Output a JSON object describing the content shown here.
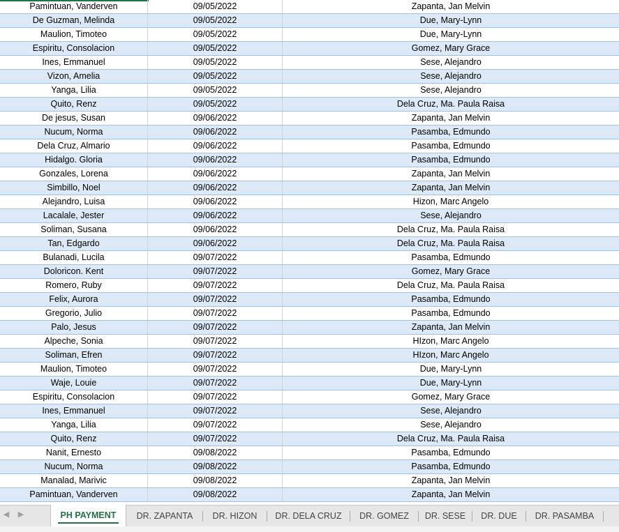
{
  "rows": [
    [
      "Pamintuan, Vanderven",
      "09/05/2022",
      "Zapanta, Jan Melvin"
    ],
    [
      "De Guzman, Melinda",
      "09/05/2022",
      "Due, Mary-Lynn"
    ],
    [
      "Maulion, Timoteo",
      "09/05/2022",
      "Due, Mary-Lynn"
    ],
    [
      "Espiritu, Consolacion",
      "09/05/2022",
      "Gomez, Mary Grace"
    ],
    [
      "Ines, Emmanuel",
      "09/05/2022",
      "Sese, Alejandro"
    ],
    [
      "Vizon, Amelia",
      "09/05/2022",
      "Sese, Alejandro"
    ],
    [
      "Yanga, Lilia",
      "09/05/2022",
      "Sese, Alejandro"
    ],
    [
      "Quito, Renz",
      "09/05/2022",
      "Dela Cruz, Ma. Paula Raisa"
    ],
    [
      "De jesus, Susan",
      "09/06/2022",
      "Zapanta, Jan Melvin"
    ],
    [
      "Nucum, Norma",
      "09/06/2022",
      "Pasamba, Edmundo"
    ],
    [
      "Dela Cruz, Almario",
      "09/06/2022",
      "Pasamba, Edmundo"
    ],
    [
      "Hidalgo. Gloria",
      "09/06/2022",
      "Pasamba, Edmundo"
    ],
    [
      "Gonzales, Lorena",
      "09/06/2022",
      "Zapanta, Jan Melvin"
    ],
    [
      "Simbillo, Noel",
      "09/06/2022",
      "Zapanta, Jan Melvin"
    ],
    [
      "Alejandro, Luisa",
      "09/06/2022",
      "Hizon, Marc Angelo"
    ],
    [
      "Lacalale, Jester",
      "09/06/2022",
      "Sese, Alejandro"
    ],
    [
      "Soliman, Susana",
      "09/06/2022",
      "Dela Cruz, Ma. Paula Raisa"
    ],
    [
      "Tan, Edgardo",
      "09/06/2022",
      "Dela Cruz, Ma. Paula Raisa"
    ],
    [
      "Bulanadi, Lucila",
      "09/07/2022",
      "Pasamba, Edmundo"
    ],
    [
      "Doloricon. Kent",
      "09/07/2022",
      "Gomez, Mary Grace"
    ],
    [
      "Romero, Ruby",
      "09/07/2022",
      "Dela Cruz, Ma. Paula Raisa"
    ],
    [
      "Felix, Aurora",
      "09/07/2022",
      "Pasamba, Edmundo"
    ],
    [
      "Gregorio, Julio",
      "09/07/2022",
      "Pasamba, Edmundo"
    ],
    [
      "Palo, Jesus",
      "09/07/2022",
      "Zapanta, Jan Melvin"
    ],
    [
      "Alpeche, Sonia",
      "09/07/2022",
      "HIzon, Marc Angelo"
    ],
    [
      "Soliman, Efren",
      "09/07/2022",
      "HIzon, Marc Angelo"
    ],
    [
      "Maulion, Timoteo",
      "09/07/2022",
      "Due, Mary-Lynn"
    ],
    [
      "Waje, Louie",
      "09/07/2022",
      "Due, Mary-Lynn"
    ],
    [
      "Espiritu, Consolacion",
      "09/07/2022",
      "Gomez, Mary Grace"
    ],
    [
      "Ines, Emmanuel",
      "09/07/2022",
      "Sese, Alejandro"
    ],
    [
      "Yanga, Lilia",
      "09/07/2022",
      "Sese, Alejandro"
    ],
    [
      "Quito, Renz",
      "09/07/2022",
      "Dela Cruz, Ma. Paula Raisa"
    ],
    [
      "Nanit, Ernesto",
      "09/08/2022",
      "Pasamba, Edmundo"
    ],
    [
      "Nucum, Norma",
      "09/08/2022",
      "Pasamba, Edmundo"
    ],
    [
      "Manalad, Marivic",
      "09/08/2022",
      "Zapanta, Jan Melvin"
    ],
    [
      "Pamintuan, Vanderven",
      "09/08/2022",
      "Zapanta, Jan Melvin"
    ]
  ],
  "sheet_tabs": [
    "PH PAYMENT",
    "DR. ZAPANTA",
    "DR. HIZON",
    "DR. DELA CRUZ",
    "DR. GOMEZ",
    "DR. SESE",
    "DR. DUE",
    "DR. PASAMBA"
  ],
  "active_tab": "PH PAYMENT",
  "nav": {
    "prev": "◀",
    "next": "▶"
  },
  "status_text": "",
  "colors": {
    "accent": "#217346",
    "band": "#dde9f6",
    "border": "#9bc2e6"
  }
}
